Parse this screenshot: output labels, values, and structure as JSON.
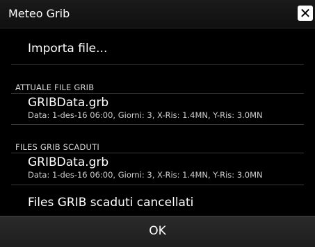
{
  "window": {
    "title": "Meteo Grib",
    "close_symbol": "✕"
  },
  "import": {
    "label": "Importa file..."
  },
  "current": {
    "header": "ATTUALE FILE GRIB",
    "file": {
      "name": "GRIBData.grb",
      "details": "Data: 1-des-16 06:00, Giorni: 3, X-Ris: 1.4MN, Y-Ris: 3.0MN"
    }
  },
  "expired": {
    "header": "FILES GRIB SCADUTI",
    "file": {
      "name": "GRIBData.grb",
      "details": "Data: 1-des-16 06:00, Giorni: 3, X-Ris: 1.4MN, Y-Ris: 3.0MN"
    },
    "delete_label": "Files GRIB scaduti cancellati"
  },
  "footer": {
    "ok_label": "OK"
  }
}
